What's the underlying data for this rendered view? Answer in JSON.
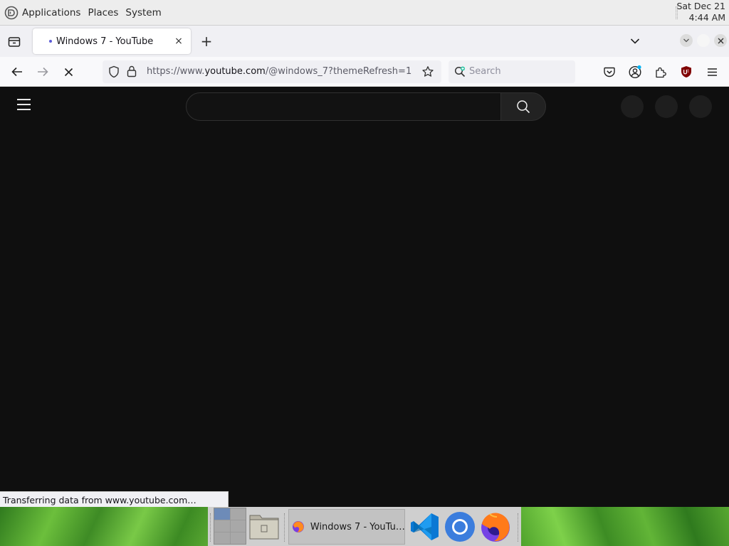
{
  "desktop_panel": {
    "menu": [
      "Applications",
      "Places",
      "System"
    ],
    "clock_date": "Sat Dec 21",
    "clock_time": "4:44 AM"
  },
  "browser": {
    "tab": {
      "title": "Windows 7 - YouTube",
      "close_glyph": "×"
    },
    "new_tab_glyph": "+",
    "url": {
      "prefix": "https://www.",
      "host": "youtube.com",
      "path": "/@windows_7?themeRefresh=1"
    },
    "search_placeholder": "Search",
    "status_text": "Transferring data from www.youtube.com…"
  },
  "page": {
    "search_value": ""
  },
  "taskbar": {
    "window_button_label": "Windows 7 - YouTu…"
  },
  "icons": {
    "top_panel_logo": "desktop-logo-icon",
    "tab_list": "tab-list-icon",
    "back": "arrow-left-icon",
    "forward": "arrow-right-icon",
    "stop": "stop-loading-icon",
    "shield": "tracking-shield-icon",
    "lock": "lock-icon",
    "bookmark": "star-icon",
    "pocket": "pocket-icon",
    "account": "account-icon",
    "extensions": "puzzle-icon",
    "ublock": "ublock-origin-icon",
    "app_menu": "hamburger-menu-icon",
    "vscode": "vscode-icon",
    "chromium": "chromium-icon",
    "firefox": "firefox-icon"
  },
  "colors": {
    "page_bg": "#0f0f0f",
    "urlbar_bg": "#f0f0f4",
    "ublock_red": "#800000",
    "vscode_blue": "#0a78d4",
    "chromium_blue": "#3b7ddd"
  }
}
